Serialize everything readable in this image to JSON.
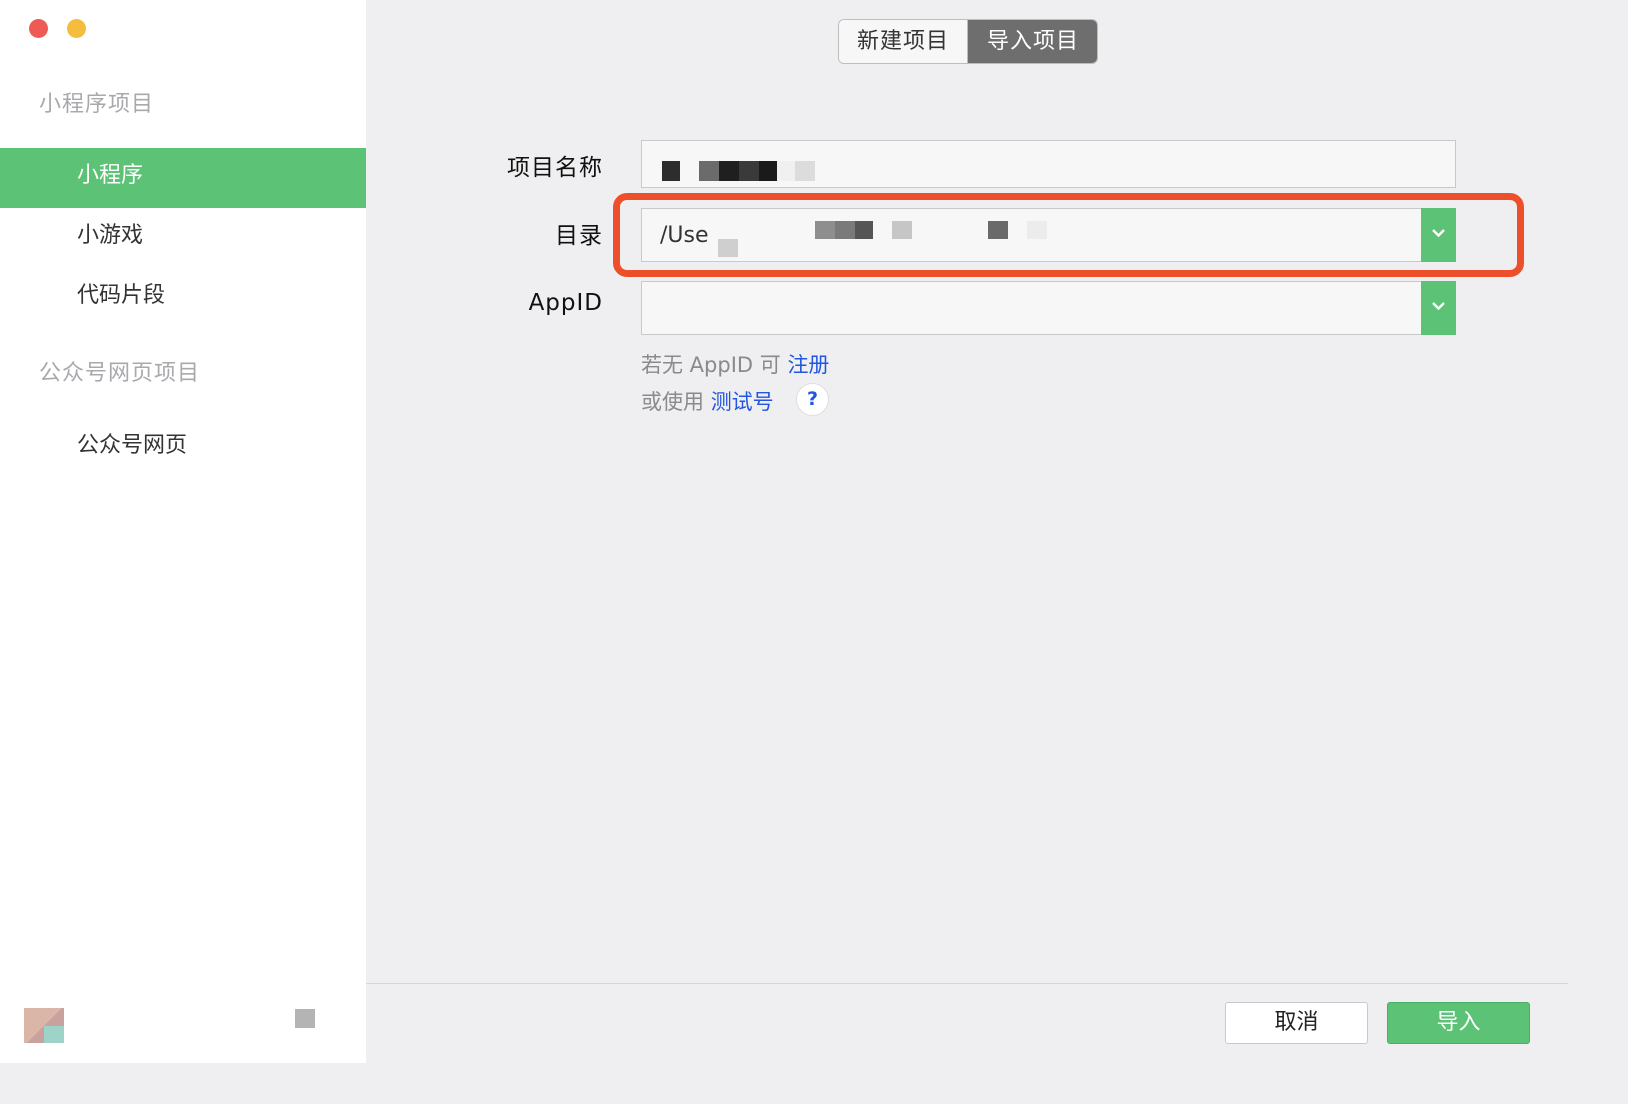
{
  "sidebar": {
    "section_miniprogram": "小程序项目",
    "items": [
      {
        "label": "小程序"
      },
      {
        "label": "小游戏"
      },
      {
        "label": "代码片段"
      }
    ],
    "section_official": "公众号网页项目",
    "official_items": [
      {
        "label": "公众号网页"
      }
    ]
  },
  "tabs": {
    "new_project": "新建项目",
    "import_project": "导入项目"
  },
  "form": {
    "project_name_label": "项目名称",
    "directory_label": "目录",
    "directory_value": "/Use",
    "appid_label": "AppID",
    "appid_value": ""
  },
  "hints": {
    "no_appid_prefix": "若无 AppID 可",
    "register_link": "注册",
    "use_prefix": "或使用",
    "test_account_link": "测试号",
    "help_symbol": "?"
  },
  "buttons": {
    "cancel": "取消",
    "import": "导入"
  },
  "colors": {
    "accent_green": "#5bc276",
    "highlight_red": "#ee4f2b",
    "link_blue": "#2157e0"
  }
}
